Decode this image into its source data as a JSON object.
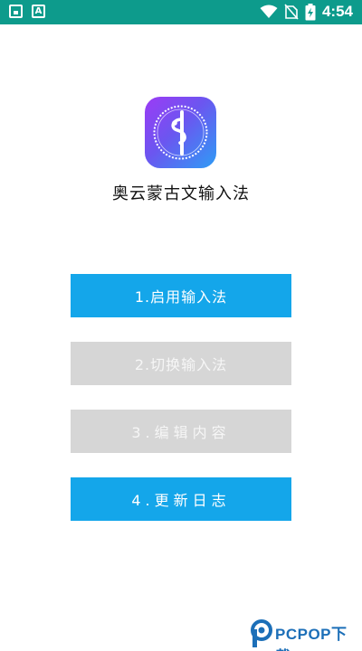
{
  "status_bar": {
    "time": "4:54",
    "left_icons": [
      "lock-notification-icon",
      "text-notification-icon"
    ],
    "right_icons": [
      "wifi-icon",
      "no-sim-icon",
      "battery-charging-icon"
    ],
    "color": "#0d9b8c"
  },
  "app": {
    "name": "奥云蒙古文输入法",
    "logo_icon": "mongolian-script-logo-icon"
  },
  "menu": {
    "enable": "1.启用输入法",
    "switch": "2.切换输入法",
    "edit": "3.编辑内容",
    "log": "4.更新日志"
  },
  "colors": {
    "active": "#14a6ea",
    "disabled": "#d6d6d6"
  },
  "watermark": {
    "text": "PCPOP下载"
  }
}
